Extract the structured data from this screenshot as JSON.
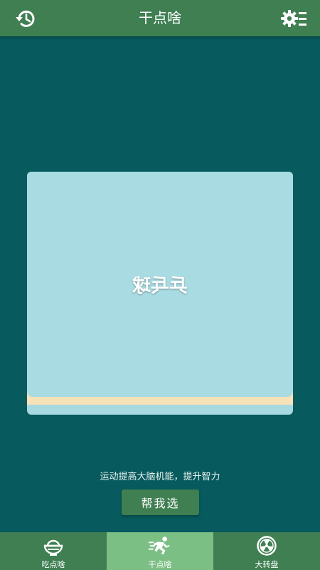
{
  "header": {
    "title": "干点啥",
    "history_icon": "history-icon",
    "settings_icon": "settings-list-icon"
  },
  "card": {
    "word": "乒乓球"
  },
  "tagline": "运动提高大脑机能，提升智力",
  "choose_button": "帮我选",
  "nav": {
    "items": [
      {
        "label": "吃点啥",
        "icon": "rice-bowl-icon",
        "active": false
      },
      {
        "label": "干点啥",
        "icon": "running-icon",
        "active": true
      },
      {
        "label": "大转盘",
        "icon": "wheel-icon",
        "active": false
      }
    ]
  },
  "colors": {
    "background": "#075a5d",
    "bar": "#3f7f52",
    "card": "#a9dbe2",
    "card_band": "#f7e1b8",
    "active_tab": "#7cbf85"
  }
}
